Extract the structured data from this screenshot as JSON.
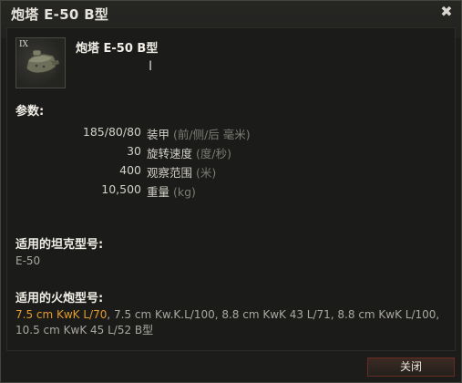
{
  "window": {
    "title": "炮塔 E-50 B型",
    "close_icon": "close-x-icon"
  },
  "module": {
    "tier": "IX",
    "icon": "turret-icon",
    "name": "炮塔 E-50 B型"
  },
  "params": {
    "label": "参数:",
    "rows": [
      {
        "value": "185/80/80",
        "name": "装甲",
        "unit": "(前/侧/后 毫米)"
      },
      {
        "value": "30",
        "name": "旋转速度",
        "unit": "(度/秒)"
      },
      {
        "value": "400",
        "name": "观察范围",
        "unit": "(米)"
      },
      {
        "value": "10,500",
        "name": "重量",
        "unit": "(kg)"
      }
    ]
  },
  "tanks": {
    "label": "适用的坦克型号:",
    "list": "E-50"
  },
  "guns": {
    "label": "适用的火炮型号:",
    "active": "7.5 cm KwK L/70",
    "rest": ", 7.5 cm Kw.K.L/100, 8.8 cm KwK 43 L/71, 8.8 cm KwK  L/100, 10.5 cm KwK 45 L/52  B型"
  },
  "footer": {
    "close_label": "关闭"
  },
  "colors": {
    "active_gun": "#e39a2e",
    "background": "#1b1b19",
    "button_border": "#6a2a1f"
  }
}
